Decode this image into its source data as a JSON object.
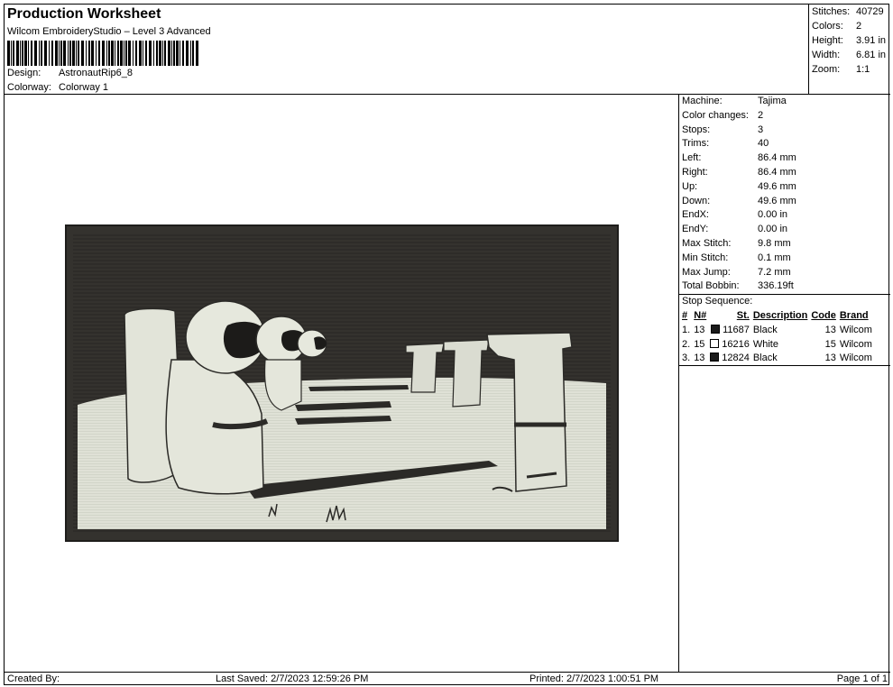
{
  "header": {
    "title": "Production Worksheet",
    "software": "Wilcom EmbroideryStudio – Level 3 Advanced",
    "design_label": "Design:",
    "design_value": "AstronautRip6_8",
    "colorway_label": "Colorway:",
    "colorway_value": "Colorway 1"
  },
  "summary": {
    "stitches_label": "Stitches:",
    "stitches": "40729",
    "colors_label": "Colors:",
    "colors": "2",
    "height_label": "Height:",
    "height": "3.91 in",
    "width_label": "Width:",
    "width": "6.81 in",
    "zoom_label": "Zoom:",
    "zoom": "1:1"
  },
  "details": [
    {
      "label": "Machine:",
      "value": "Tajima"
    },
    {
      "label": "Color changes:",
      "value": "2"
    },
    {
      "label": "Stops:",
      "value": "3"
    },
    {
      "label": "Trims:",
      "value": "40"
    },
    {
      "label": "Left:",
      "value": "86.4 mm"
    },
    {
      "label": "Right:",
      "value": "86.4 mm"
    },
    {
      "label": "Up:",
      "value": "49.6 mm"
    },
    {
      "label": "Down:",
      "value": "49.6 mm"
    },
    {
      "label": "EndX:",
      "value": "0.00 in"
    },
    {
      "label": "EndY:",
      "value": "0.00 in"
    },
    {
      "label": "Max Stitch:",
      "value": "9.8 mm"
    },
    {
      "label": "Min Stitch:",
      "value": "0.1 mm"
    },
    {
      "label": "Max Jump:",
      "value": "7.2 mm"
    },
    {
      "label": "Total Bobbin:",
      "value": "336.19ft"
    }
  ],
  "stop_sequence": {
    "title": "Stop Sequence:",
    "headers": {
      "num": "#",
      "n": "N#",
      "st": "St.",
      "desc": "Description",
      "code": "Code",
      "brand": "Brand"
    },
    "rows": [
      {
        "num": "1.",
        "n": "13",
        "swatch": "#1a1a1a",
        "st": "11687",
        "desc": "Black",
        "code": "13",
        "brand": "Wilcom"
      },
      {
        "num": "2.",
        "n": "15",
        "swatch": "#ffffff",
        "st": "16216",
        "desc": "White",
        "code": "15",
        "brand": "Wilcom"
      },
      {
        "num": "3.",
        "n": "13",
        "swatch": "#1a1a1a",
        "st": "12824",
        "desc": "Black",
        "code": "13",
        "brand": "Wilcom"
      }
    ]
  },
  "footer": {
    "created_by": "Created By:",
    "last_saved": "Last Saved: 2/7/2023 12:59:26 PM",
    "printed": "Printed: 2/7/2023 1:00:51 PM",
    "page": "Page 1 of 1"
  },
  "colors": {
    "thread_dark": "#2b2a27",
    "thread_light": "#d9dcd2"
  }
}
